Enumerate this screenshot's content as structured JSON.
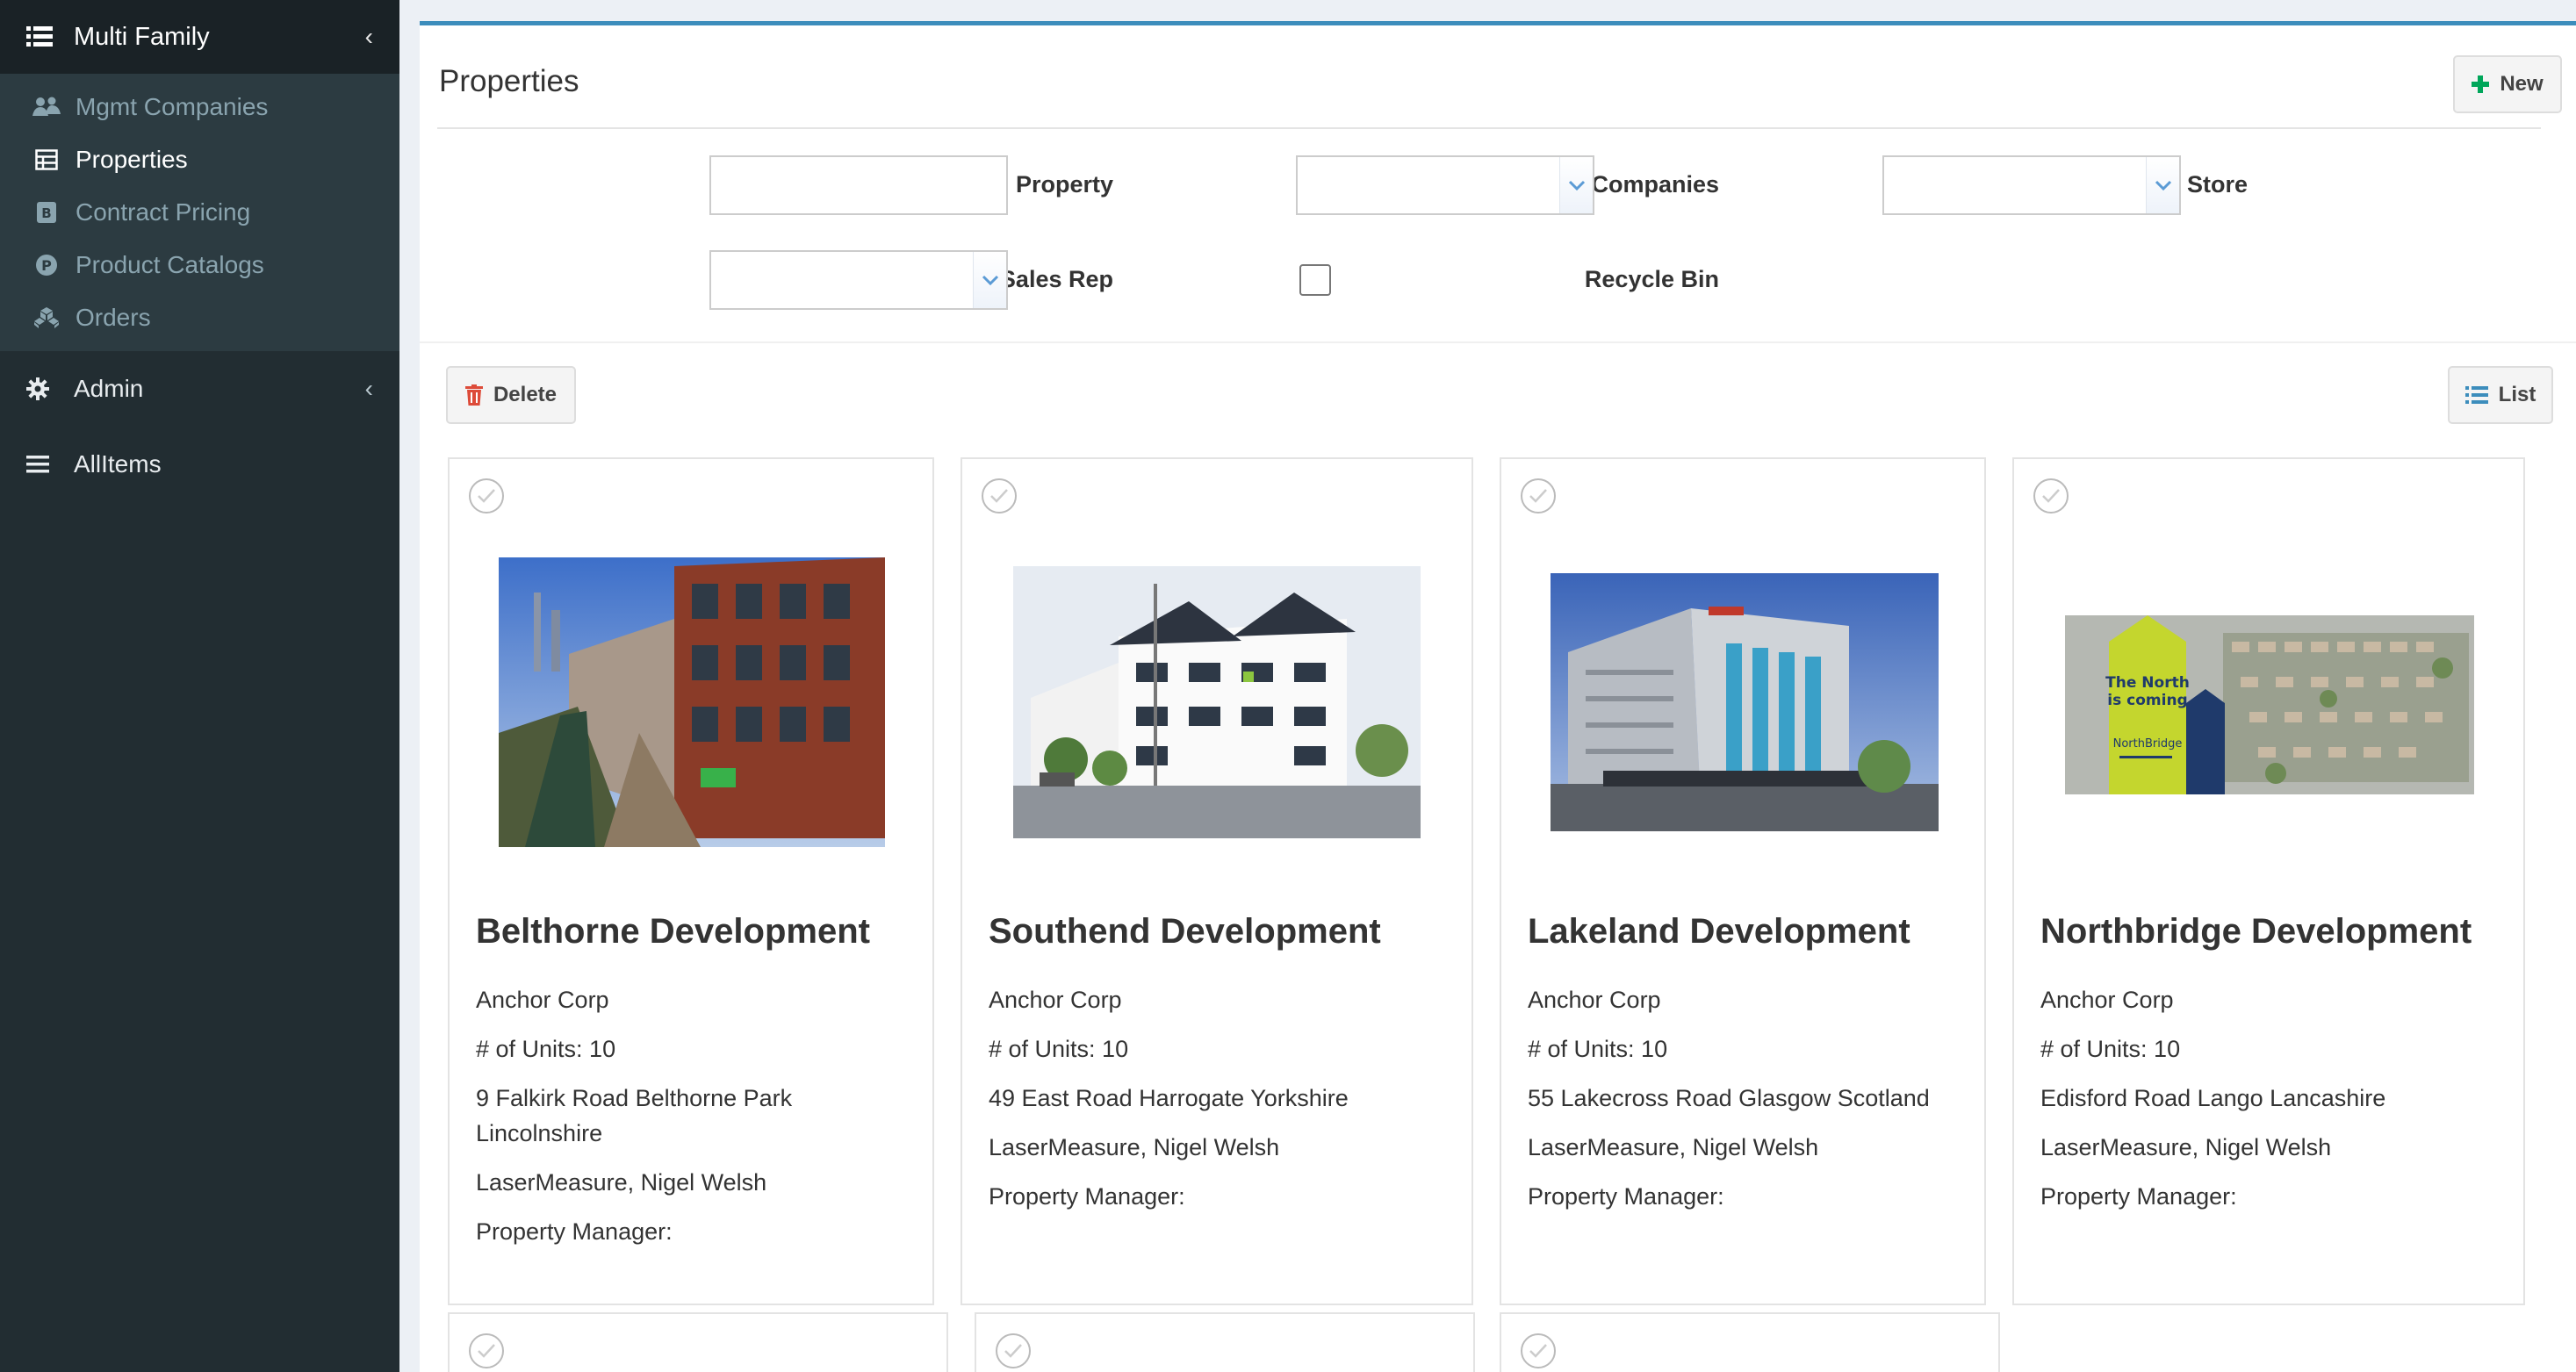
{
  "sidebar": {
    "header": {
      "label": "Multi Family",
      "icon": "list-icon"
    },
    "items": [
      {
        "label": "Mgmt Companies",
        "icon": "users-icon",
        "active": false
      },
      {
        "label": "Properties",
        "icon": "table-icon",
        "active": true
      },
      {
        "label": "Contract Pricing",
        "icon": "pricing-icon",
        "active": false
      },
      {
        "label": "Product Catalogs",
        "icon": "product-icon",
        "active": false
      },
      {
        "label": "Orders",
        "icon": "cubes-icon",
        "active": false
      }
    ],
    "admin": {
      "label": "Admin",
      "icon": "gear-icon"
    },
    "allitems": {
      "label": "AllItems",
      "icon": "bars-icon"
    }
  },
  "page": {
    "title": "Properties",
    "new_label": "New",
    "delete_label": "Delete",
    "list_label": "List"
  },
  "filters": {
    "property_label": "Property",
    "property_value": "",
    "mgmt_companies_label": "Mgmt Companies",
    "store_label": "Store",
    "sales_rep_label": "Sales Rep",
    "recycle_bin_label": "Recycle Bin"
  },
  "colors": {
    "sidebar_bg": "#222d32",
    "accent": "#3c8dbc",
    "new_icon": "#00a65a",
    "delete_icon": "#dd4b39",
    "list_icon": "#3c8dbc"
  },
  "cards": [
    {
      "title": "Belthorne Development",
      "company": "Anchor Corp",
      "units": "# of Units: 10",
      "address": "9 Falkirk Road Belthorne Park Lincolnshire",
      "contacts": "LaserMeasure, Nigel Welsh",
      "manager": "Property Manager:"
    },
    {
      "title": "Southend Development",
      "company": "Anchor Corp",
      "units": "# of Units: 10",
      "address": "49 East Road Harrogate Yorkshire",
      "contacts": "LaserMeasure, Nigel Welsh",
      "manager": "Property Manager:"
    },
    {
      "title": "Lakeland Development",
      "company": "Anchor Corp",
      "units": "# of Units: 10",
      "address": "55 Lakecross Road Glasgow Scotland",
      "contacts": "LaserMeasure, Nigel Welsh",
      "manager": "Property Manager:"
    },
    {
      "title": "Northbridge Development",
      "company": "Anchor Corp",
      "units": "# of Units: 10",
      "address": "Edisford Road Lango Lancashire",
      "contacts": "LaserMeasure, Nigel Welsh",
      "manager": "Property Manager:",
      "image_text": {
        "line1": "The North",
        "line2": "is coming",
        "brand": "NorthBridge"
      }
    }
  ]
}
